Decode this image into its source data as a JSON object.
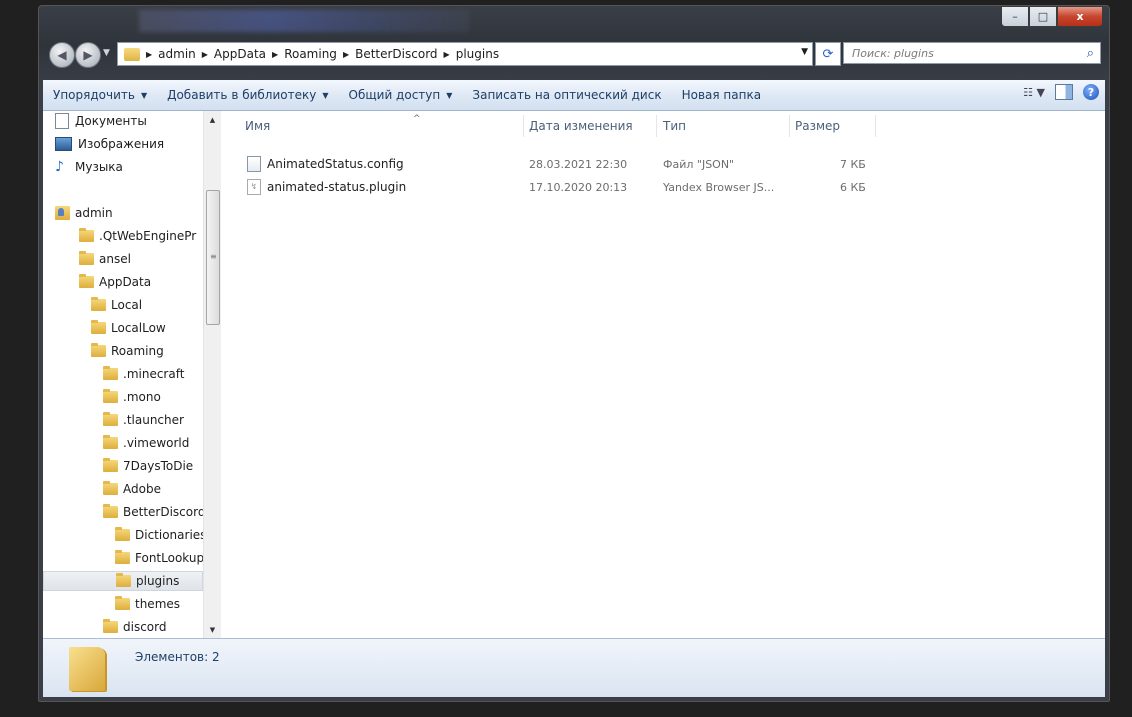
{
  "window": {
    "controls": {
      "minimize": "–",
      "maximize": "□",
      "close": "x"
    }
  },
  "address": {
    "crumbs": [
      "admin",
      "AppData",
      "Roaming",
      "BetterDiscord",
      "plugins"
    ],
    "search_placeholder": "Поиск: plugins"
  },
  "toolbar": {
    "organize": "Упорядочить",
    "add_to_library": "Добавить в библиотеку",
    "share": "Общий доступ",
    "burn": "Записать на оптический диск",
    "new_folder": "Новая папка"
  },
  "navpane": {
    "items": [
      {
        "label": "Документы",
        "icon": "document-icon",
        "indent": 0
      },
      {
        "label": "Изображения",
        "icon": "images-icon",
        "indent": 0
      },
      {
        "label": "Музыка",
        "icon": "music-icon",
        "indent": 0
      },
      {
        "label": "admin",
        "icon": "user-folder-icon",
        "indent": 0
      },
      {
        "label": ".QtWebEnginePr",
        "icon": "folder-icon",
        "indent": 1
      },
      {
        "label": "ansel",
        "icon": "folder-icon",
        "indent": 1
      },
      {
        "label": "AppData",
        "icon": "folder-icon",
        "indent": 1
      },
      {
        "label": "Local",
        "icon": "folder-icon",
        "indent": 2
      },
      {
        "label": "LocalLow",
        "icon": "folder-icon",
        "indent": 2
      },
      {
        "label": "Roaming",
        "icon": "folder-icon",
        "indent": 2
      },
      {
        "label": ".minecraft",
        "icon": "folder-icon",
        "indent": 3
      },
      {
        "label": ".mono",
        "icon": "folder-icon",
        "indent": 3
      },
      {
        "label": ".tlauncher",
        "icon": "folder-icon",
        "indent": 3
      },
      {
        "label": ".vimeworld",
        "icon": "folder-icon",
        "indent": 3
      },
      {
        "label": "7DaysToDie",
        "icon": "folder-icon",
        "indent": 3
      },
      {
        "label": "Adobe",
        "icon": "folder-icon",
        "indent": 3
      },
      {
        "label": "BetterDiscord",
        "icon": "folder-icon",
        "indent": 3
      },
      {
        "label": "Dictionaries",
        "icon": "folder-icon",
        "indent": 4
      },
      {
        "label": "FontLookup",
        "icon": "folder-icon",
        "indent": 4
      },
      {
        "label": "plugins",
        "icon": "folder-icon",
        "indent": 4,
        "selected": true
      },
      {
        "label": "themes",
        "icon": "folder-icon",
        "indent": 4
      },
      {
        "label": "discord",
        "icon": "folder-icon",
        "indent": 3
      }
    ]
  },
  "columns": {
    "name": "Имя",
    "date": "Дата изменения",
    "type": "Тип",
    "size": "Размер"
  },
  "files": [
    {
      "name": "AnimatedStatus.config",
      "date": "28.03.2021 22:30",
      "type": "Файл \"JSON\"",
      "size": "7 КБ"
    },
    {
      "name": "animated-status.plugin",
      "date": "17.10.2020 20:13",
      "type": "Yandex Browser JS...",
      "size": "6 КБ"
    }
  ],
  "status": {
    "items_count": "Элементов: 2"
  }
}
